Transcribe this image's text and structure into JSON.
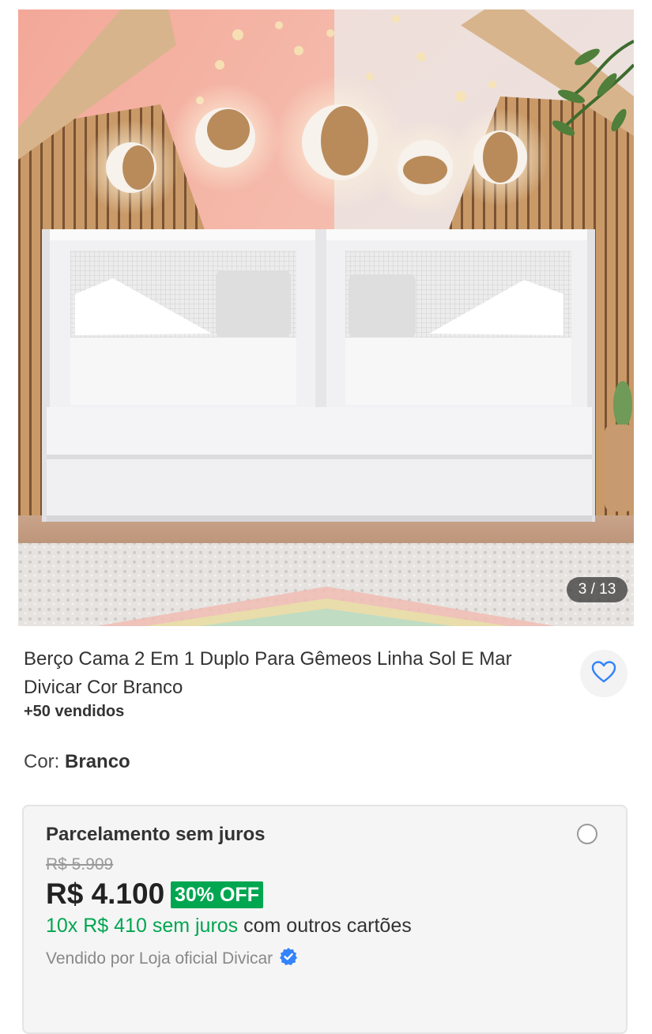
{
  "gallery": {
    "counter": "3 / 13"
  },
  "product": {
    "title": "Berço Cama 2 Em 1 Duplo Para Gêmeos Linha Sol E Mar Divicar Cor Branco",
    "sold": "+50 vendidos",
    "color_label": "Cor:",
    "color_value": "Branco"
  },
  "payment": {
    "title": "Parcelamento sem juros",
    "old_price": "R$ 5.909",
    "price": "R$ 4.100",
    "discount": "30% OFF",
    "installments_green": "10x R$ 410 sem juros",
    "installments_rest": " com outros cartões",
    "seller": "Vendido por Loja oficial Divicar"
  },
  "colors": {
    "accent": "#3483fa",
    "discount_bg": "#00a650",
    "installments": "#00a650"
  },
  "icons": {
    "favorite": "heart-outline-icon",
    "verified": "verified-badge-icon"
  }
}
